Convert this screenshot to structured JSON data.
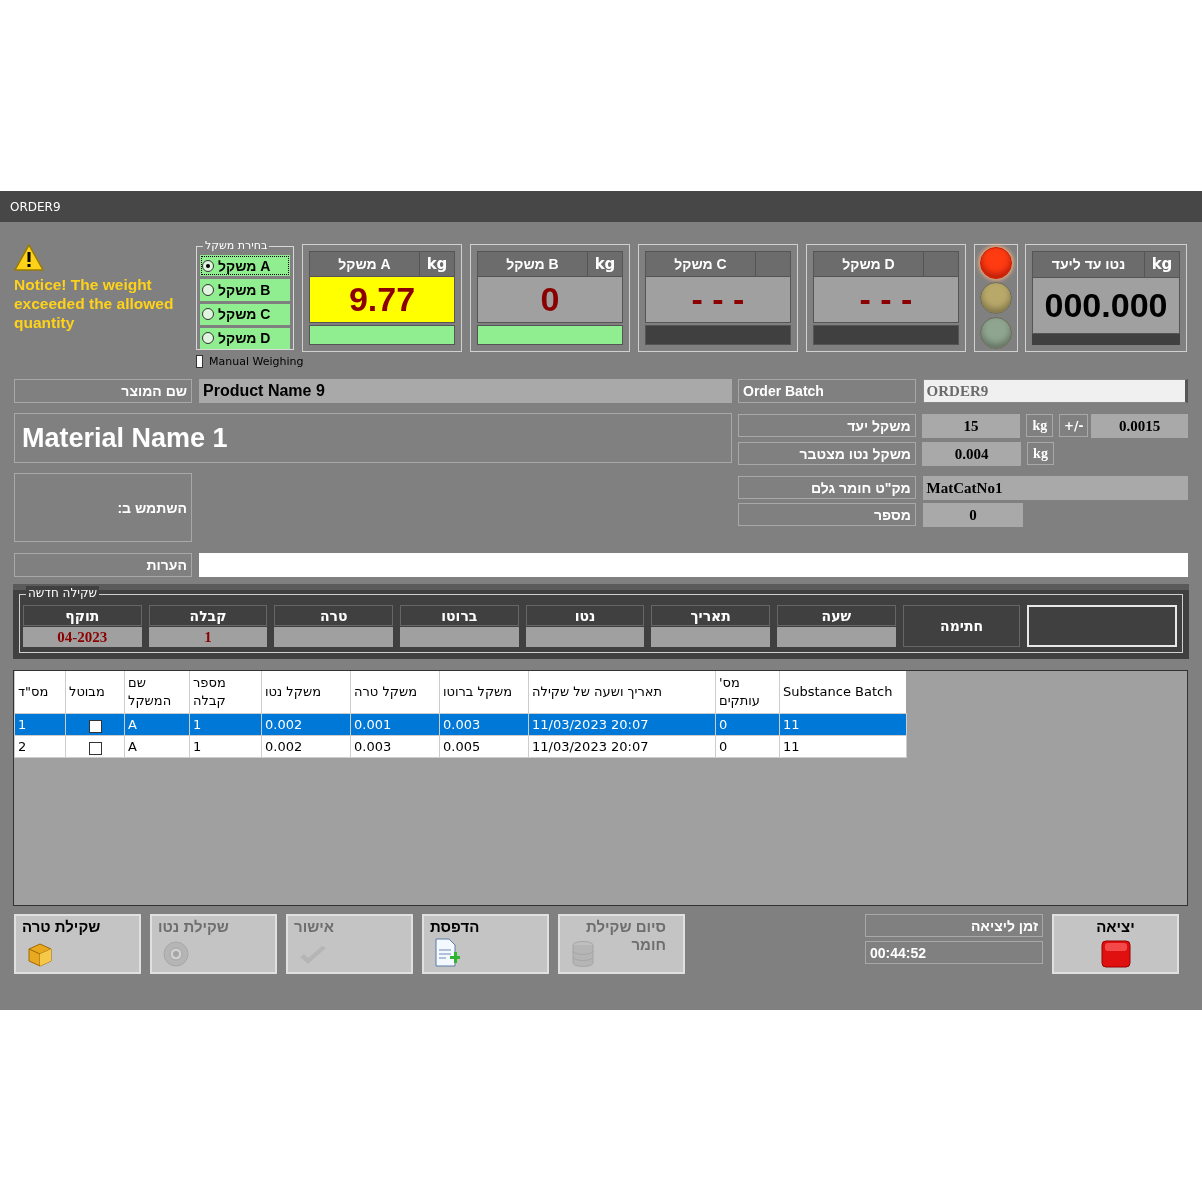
{
  "window": {
    "title": "ORDER9"
  },
  "notice": {
    "text": "Notice! The weight exceeded the allowed quantity"
  },
  "scale_select": {
    "legend": "בחירת משקל",
    "options": [
      {
        "label": "משקל A",
        "selected": true
      },
      {
        "label": "משקל B",
        "selected": false
      },
      {
        "label": "משקל C",
        "selected": false
      },
      {
        "label": "משקל D",
        "selected": false
      }
    ]
  },
  "manual_weighing": {
    "label": "Manual Weighing",
    "checked": false
  },
  "scales": [
    {
      "title": "משקל D",
      "value": "- - -",
      "alert": false,
      "active": false
    },
    {
      "title": "משקל C",
      "value": "- - -",
      "alert": false,
      "active": false
    },
    {
      "title": "משקל B",
      "unit": "kg",
      "value": "0",
      "alert": false,
      "active": true
    },
    {
      "title": "משקל A",
      "unit": "kg",
      "value": "9.77",
      "alert": true,
      "active": true
    }
  ],
  "lights": [
    {
      "color": "#ff3b12",
      "on": true
    },
    {
      "color": "#b8a86a",
      "on": false
    },
    {
      "color": "#8fa58f",
      "on": false
    }
  ],
  "net_target": {
    "title": "נטו עד ליעד",
    "unit": "kg",
    "value": "000.000"
  },
  "product": {
    "label": "שם המוצר",
    "value": "Product Name 9"
  },
  "order_batch": {
    "label": "Order Batch",
    "value": "ORDER9"
  },
  "material_name": "Material Name 1",
  "usage_label": "השתמש ב:",
  "target_weight": {
    "label": "משקל יעד",
    "value": "15",
    "unit": "kg",
    "tolerance_label": "+/-",
    "tolerance": "0.0015"
  },
  "net_accumulated": {
    "label": "משקל נטו מצטבר",
    "value": "0.004",
    "unit": "kg"
  },
  "catalog": {
    "label": "מק\"ט חומר גלם",
    "value": "MatCatNo1"
  },
  "number": {
    "label": "מספר",
    "value": "0"
  },
  "remarks": {
    "label": "הערות"
  },
  "new_weighing": {
    "legend": "שקילה חדשה",
    "columns": [
      {
        "label": "שעה"
      },
      {
        "label": "תאריך"
      },
      {
        "label": "נטו"
      },
      {
        "label": "ברוטו"
      },
      {
        "label": "טרה"
      },
      {
        "label": "קבלה",
        "value": "1"
      },
      {
        "label": "תוקף",
        "value": "04-2023"
      }
    ],
    "signature_label": "חתימה"
  },
  "table": {
    "columns": [
      "Substance Batch",
      "מס' עותקים",
      "תאריך ושעה של שקילה",
      "משקל ברוטו",
      "משקל טרה",
      "משקל נטו",
      "מספר קבלה",
      "שם המשקל",
      "מבוטל",
      "מס\"ד"
    ],
    "rows": [
      {
        "selected": true,
        "cancelled": false,
        "cells": [
          "11",
          "0",
          "11/03/2023 20:07",
          "0.003",
          "0.001",
          "0.002",
          "1",
          "A",
          "1"
        ]
      },
      {
        "selected": false,
        "cancelled": false,
        "cells": [
          "11",
          "0",
          "11/03/2023 20:07",
          "0.005",
          "0.003",
          "0.002",
          "1",
          "A",
          "2"
        ]
      }
    ]
  },
  "buttons": [
    {
      "label": "סיום שקילת חומר",
      "disabled": true
    },
    {
      "label": "הדפסת",
      "disabled": false
    },
    {
      "label": "אישור",
      "disabled": true
    },
    {
      "label": "שקילת נטו",
      "disabled": true
    },
    {
      "label": "שקילת טרה",
      "disabled": false
    }
  ],
  "exit_time": {
    "label": "זמן ליציאה",
    "value": "00:44:52"
  },
  "exit_button": {
    "label": "יציאה"
  }
}
